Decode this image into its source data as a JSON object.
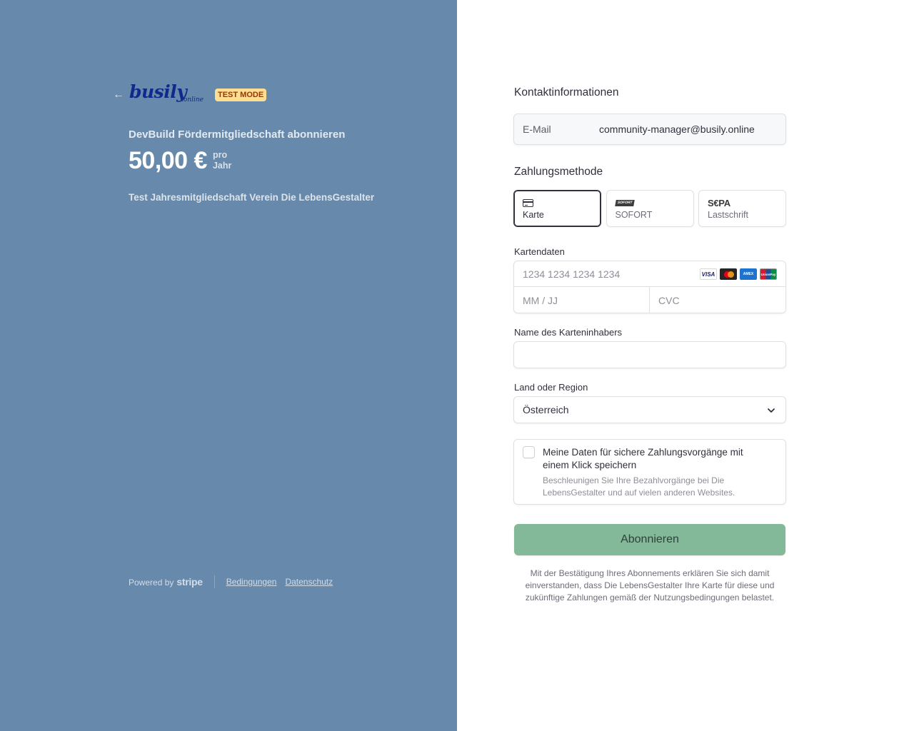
{
  "colors": {
    "left_panel": "#678aac",
    "accent_button": "#83b899",
    "test_badge_bg": "#ffde92"
  },
  "brand": {
    "back_icon": "arrow-left-icon",
    "logo_main": "busily",
    "logo_sub": ".online",
    "test_mode": "TEST MODE"
  },
  "summary": {
    "product_title": "DevBuild Fördermitgliedschaft abonnieren",
    "price": "50,00 €",
    "per_1": "pro",
    "per_2": "Jahr",
    "description": "Test Jahresmitgliedschaft Verein Die LebensGestalter"
  },
  "footer": {
    "powered_by": "Powered by",
    "stripe": "stripe",
    "terms": "Bedingungen",
    "privacy": "Datenschutz"
  },
  "contact": {
    "title": "Kontaktinformationen",
    "email_label": "E-Mail",
    "email_value": "community-manager@busily.online"
  },
  "payment": {
    "title": "Zahlungsmethode",
    "methods": [
      {
        "label": "Karte",
        "icon": "credit-card-icon",
        "selected": true
      },
      {
        "label": "SOFORT",
        "icon": "sofort-logo",
        "selected": false
      },
      {
        "label": "Lastschrift",
        "icon": "sepa-logo",
        "selected": false
      }
    ],
    "sofort_logo_text": "SOFORT",
    "sepa_logo_text": "S€PA"
  },
  "card": {
    "label": "Kartendaten",
    "number_placeholder": "1234 1234 1234 1234",
    "expiry_placeholder": "MM / JJ",
    "cvc_placeholder": "CVC",
    "brands": [
      "VISA",
      "mastercard",
      "AMEX",
      "UnionPay"
    ]
  },
  "cardholder": {
    "label": "Name des Karteninhabers",
    "value": ""
  },
  "country": {
    "label": "Land oder Region",
    "selected": "Österreich",
    "icon": "chevron-down-icon"
  },
  "save": {
    "title": "Meine Daten für sichere Zahlungsvorgänge mit einem Klick speichern",
    "subtitle": "Beschleunigen Sie Ihre Bezahlvorgänge bei Die LebensGestalter und auf vielen anderen Websites.",
    "checked": false
  },
  "submit_label": "Abonnieren",
  "legal": "Mit der Bestätigung Ihres Abonnements erklären Sie sich damit einverstanden, dass Die LebensGestalter Ihre Karte für diese und zukünftige Zahlungen gemäß der Nutzungsbedingungen belastet."
}
